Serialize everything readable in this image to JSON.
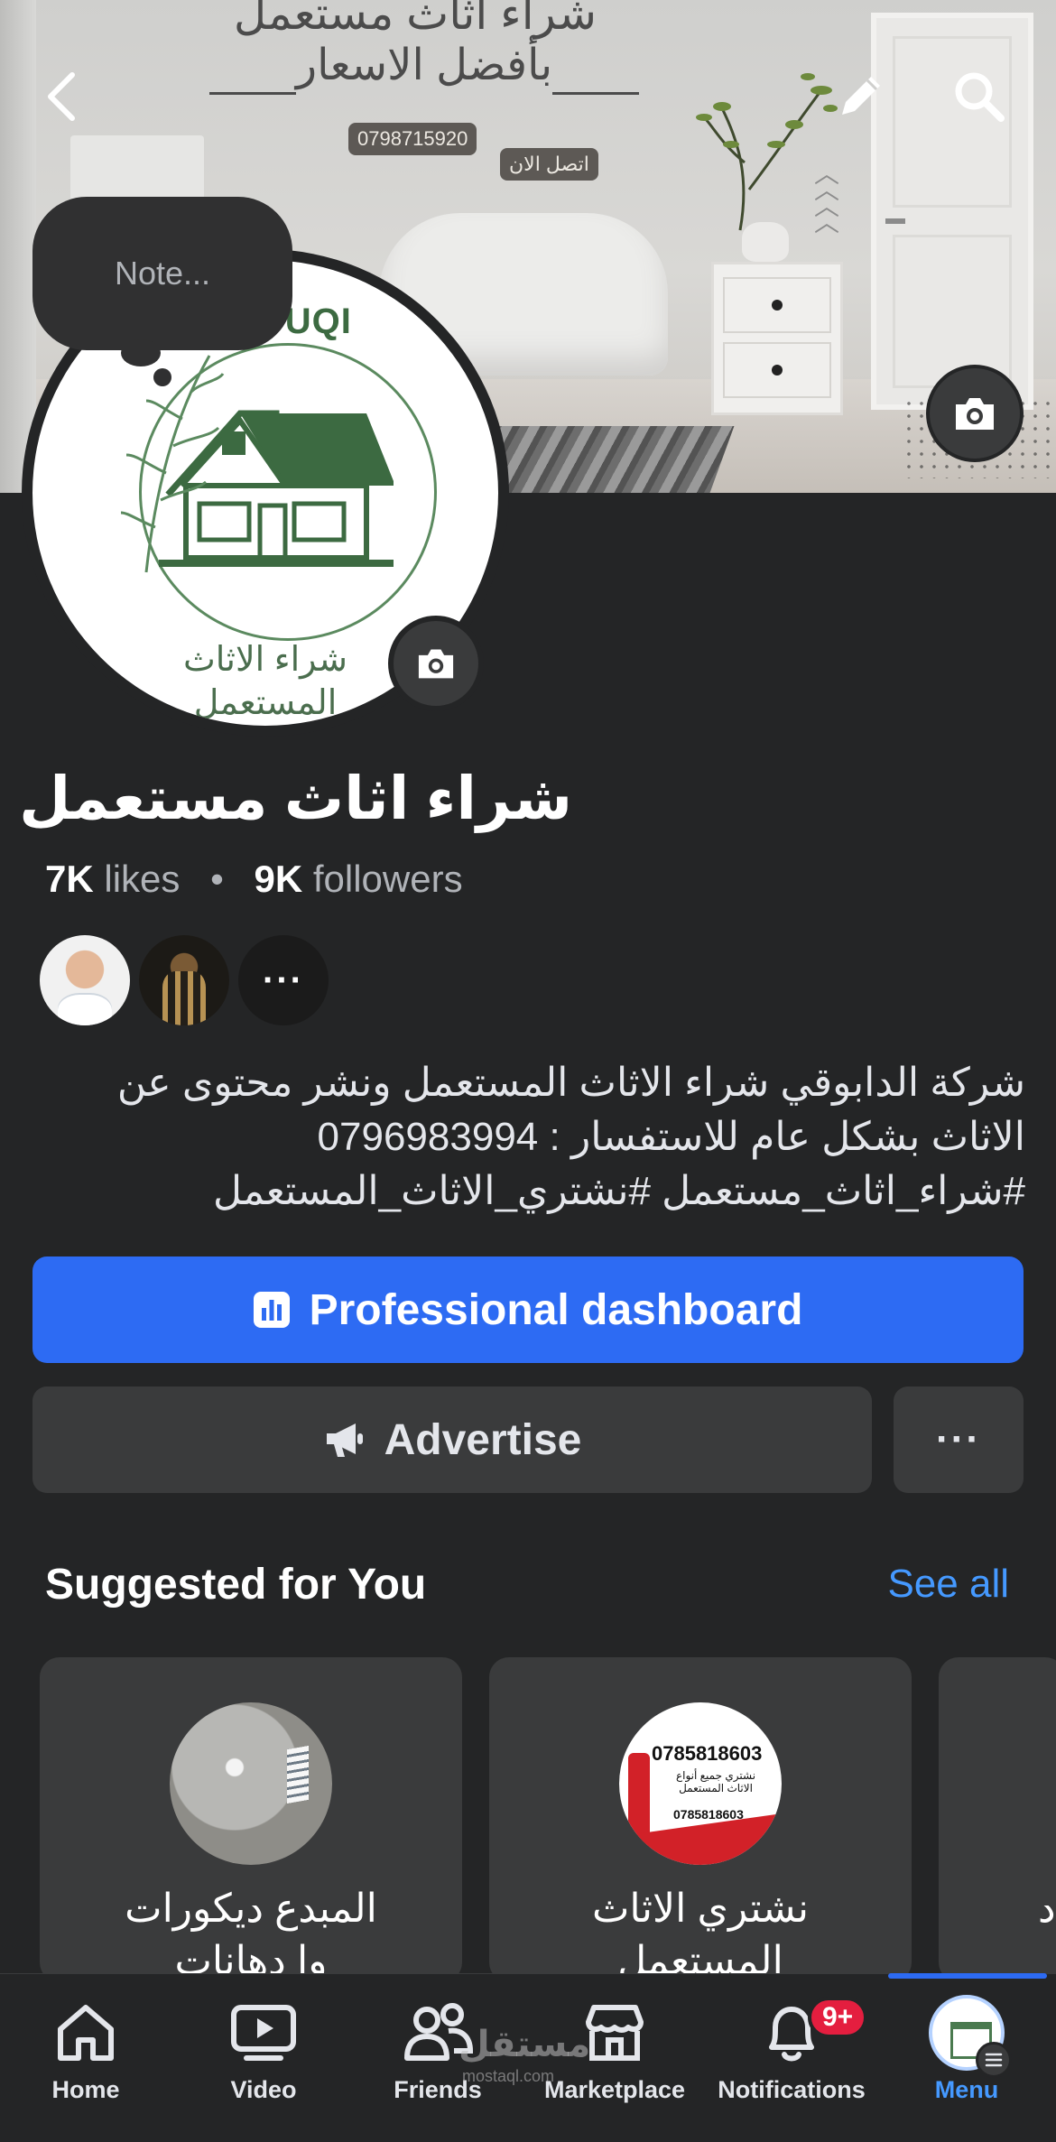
{
  "cover": {
    "headline": "شراء اثاث مستعمل",
    "subheadline": "بأفضل الاسعار",
    "phone": "0798715920",
    "contact_label": "اتصل الان"
  },
  "note": {
    "placeholder": "Note..."
  },
  "profile": {
    "logo_text": "SOUQI",
    "logo_caption_1": "شراء الاثاث",
    "logo_caption_2": "المستعمل",
    "name": "شراء اثاث مستعمل",
    "likes_count": "7K",
    "likes_label": "likes",
    "separator": "•",
    "followers_count": "9K",
    "followers_label": "followers",
    "friends_more": "···",
    "bio_lines": [
      "شركة الدابوقي شراء الاثاث المستعمل ونشر محتوى عن",
      "الاثاث بشكل عام للاستفسار : 0796983994",
      "#شراء_اثاث_مستعمل #نشتري_الاثاث_المستعمل"
    ]
  },
  "actions": {
    "dashboard_label": "Professional dashboard",
    "advertise_label": "Advertise",
    "more_label": "···"
  },
  "suggested": {
    "title": "Suggested for You",
    "see_all": "See all",
    "cards": [
      {
        "name_line1": "المبدع ديكورات",
        "name_line2": "وا دهانات"
      },
      {
        "name_line1": "نشتري الاثاث",
        "name_line2": "المستعمل",
        "pic_number": "0785818603",
        "pic_sub": "نشتري جميع أنواع الاثاث المستعمل",
        "pic_number2": "0785818603"
      },
      {
        "name_line1": "د"
      }
    ]
  },
  "tabbar": {
    "tabs": [
      {
        "label": "Home",
        "icon": "home-icon"
      },
      {
        "label": "Video",
        "icon": "video-icon"
      },
      {
        "label": "Friends",
        "icon": "friends-icon"
      },
      {
        "label": "Marketplace",
        "icon": "marketplace-icon"
      },
      {
        "label": "Notifications",
        "icon": "bell-icon",
        "badge": "9+"
      },
      {
        "label": "Menu",
        "icon": "menu-avatar",
        "active": true
      }
    ]
  },
  "watermark": {
    "text": "مستقل",
    "sub": "mostaql.com"
  },
  "colors": {
    "background": "#242526",
    "primary": "#2d6bf3",
    "link": "#4599ff",
    "badge": "#e41e3f",
    "button_secondary": "#3a3b3c"
  }
}
